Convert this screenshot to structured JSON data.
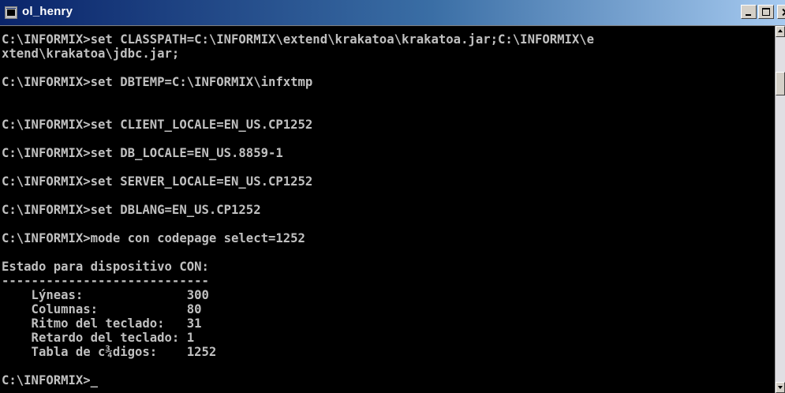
{
  "window": {
    "title": "ol_henry",
    "icon": "console-icon"
  },
  "console": {
    "lines": [
      "C:\\INFORMIX>set CLASSPATH=C:\\INFORMIX\\extend\\krakatoa\\krakatoa.jar;C:\\INFORMIX\\e",
      "xtend\\krakatoa\\jdbc.jar;",
      "C:\\INFORMIX>set DBTEMP=C:\\INFORMIX\\infxtmp",
      "C:\\INFORMIX>set CLIENT_LOCALE=EN_US.CP1252",
      "C:\\INFORMIX>set DB_LOCALE=EN_US.8859-1",
      "C:\\INFORMIX>set SERVER_LOCALE=EN_US.CP1252",
      "C:\\INFORMIX>set DBLANG=EN_US.CP1252",
      "C:\\INFORMIX>mode con codepage select=1252",
      "Estado para dispositivo CON:",
      "----------------------------",
      "    Lýneas:              300",
      "    Columnas:            80",
      "    Ritmo del teclado:   31",
      "    Retardo del teclado: 1",
      "    Tabla de c¾digos:    1252",
      "C:\\INFORMIX>_"
    ]
  },
  "colors": {
    "console_bg": "#000000",
    "console_fg": "#c0c0c0",
    "titlebar_start": "#0a246a",
    "titlebar_end": "#a6caf0"
  }
}
